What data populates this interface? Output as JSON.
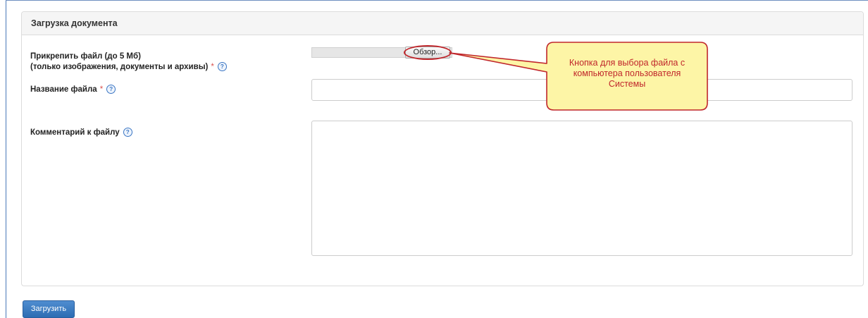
{
  "panel": {
    "title": "Загрузка документа"
  },
  "form": {
    "attach": {
      "label_line1": "Прикрепить файл (до 5 Мб)",
      "label_line2": "(только изображения, документы и архивы)",
      "required_mark": "*",
      "help_icon": "?",
      "browse_label": "Обзор..."
    },
    "file_name": {
      "label": "Название файла",
      "required_mark": "*",
      "help_icon": "?",
      "value": ""
    },
    "comment": {
      "label": "Комментарий к файлу",
      "help_icon": "?",
      "value": ""
    }
  },
  "actions": {
    "submit_label": "Загрузить"
  },
  "annotation": {
    "callout_line1": "Кнопка для выбора файла с",
    "callout_line2": "компьютера пользователя",
    "callout_line3": "Системы"
  },
  "colors": {
    "accent": "#3a76c4",
    "required": "#d9534f",
    "callout_fill": "#fdf5a6",
    "callout_border": "#c0262b"
  }
}
